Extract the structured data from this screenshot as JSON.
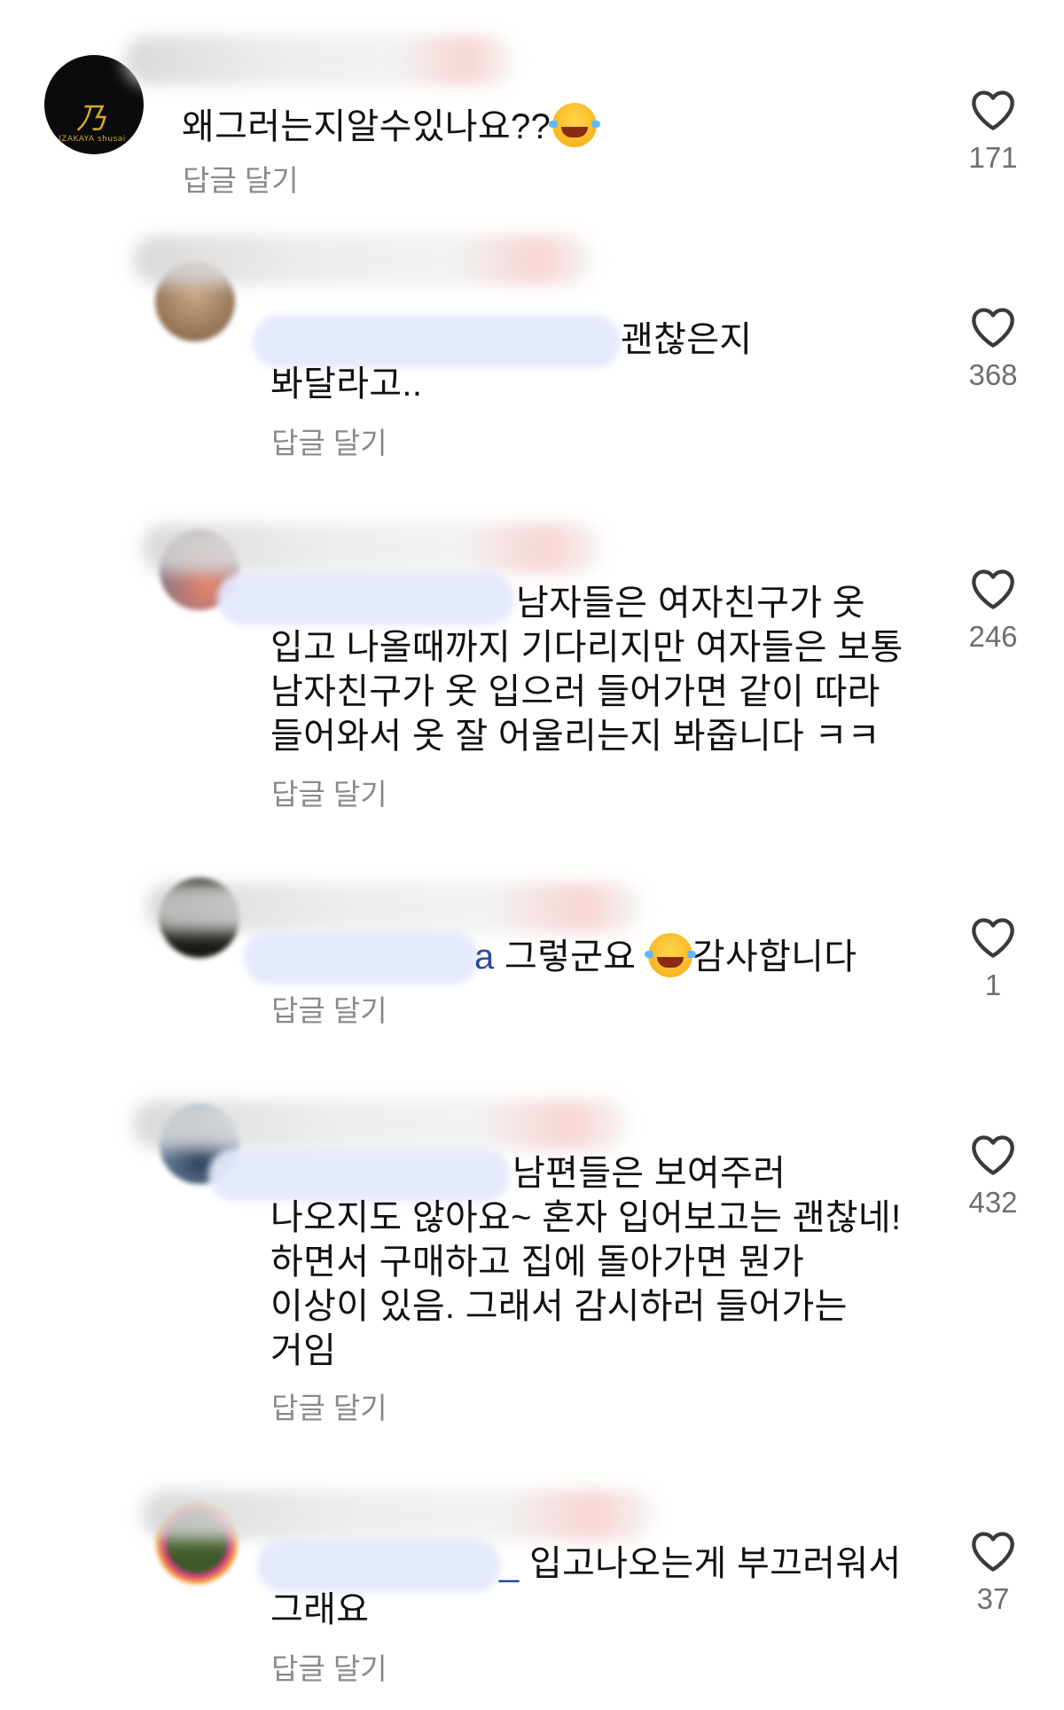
{
  "comments": [
    {
      "text": "왜그러는지알수있나요??",
      "emoji": "face-with-tears-of-joy",
      "reply": "답글 달기",
      "likes": "171",
      "avatar_caption": "IZAKAYA shusai"
    },
    {
      "lines": [
        "괜찮은지",
        "봐달라고.."
      ],
      "reply": "답글 달기",
      "likes": "368"
    },
    {
      "lines": [
        "남자들은 여자친구가 옷",
        "입고 나올때까지 기다리지만 여자들은 보통",
        "남자친구가 옷 입으러 들어가면 같이 따라",
        "들어와서 옷 잘 어울리는지 봐줍니다 ㅋㅋ"
      ],
      "reply": "답글 달기",
      "likes": "246"
    },
    {
      "mention_tail": "a",
      "text_before_emoji": "그렇군요",
      "emoji": "face-with-tears-of-joy",
      "text_after_emoji": "감사합니다",
      "reply": "답글 달기",
      "likes": "1"
    },
    {
      "lines": [
        "남편들은 보여주러",
        "나오지도 않아요~ 혼자 입어보고는 괜찮네!",
        "하면서 구매하고 집에 돌아가면 뭔가",
        "이상이 있음. 그래서 감시하러 들어가는",
        "거임"
      ],
      "reply": "답글 달기",
      "likes": "432"
    },
    {
      "mention_tail": "_",
      "lines": [
        "입고나오는게 부끄러워서",
        "그래요"
      ],
      "reply": "답글 달기",
      "likes": "37"
    }
  ],
  "icons": {
    "like": "heart-outline-icon"
  },
  "colors": {
    "text": "#111111",
    "secondary": "#8a8a8a",
    "mention": "#2c4a9c"
  }
}
